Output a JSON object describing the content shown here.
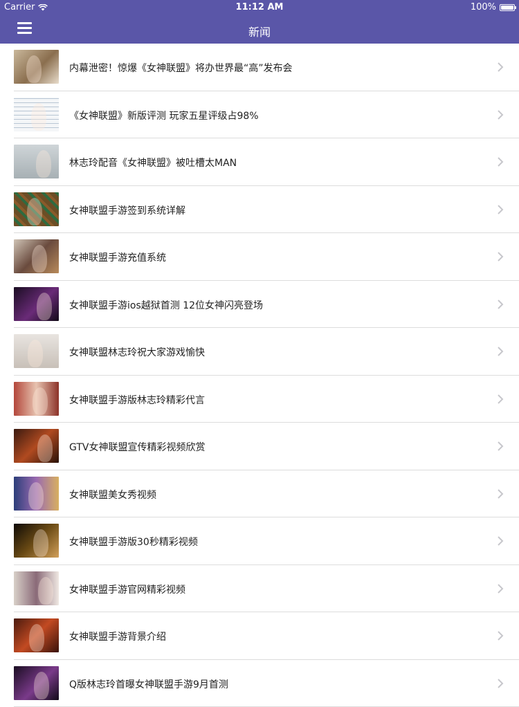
{
  "status": {
    "carrier": "Carrier",
    "time": "11:12 AM",
    "battery": "100%"
  },
  "nav": {
    "title": "新闻"
  },
  "items": [
    {
      "title": "内幕泄密！惊爆《女神联盟》将办世界最“高”发布会",
      "bg": "linear-gradient(135deg,#c9b79b,#8a6e4e 55%,#e8dccb)"
    },
    {
      "title": "《女神联盟》新版评测 玩家五星评级占98%",
      "bg": "repeating-linear-gradient(0deg,#f4f6f8 0 5px,#b9c6d4 5px 6px)"
    },
    {
      "title": "林志玲配音《女神联盟》被吐槽太MAN",
      "bg": "linear-gradient(180deg,#cfd5d8,#a7b0b4)"
    },
    {
      "title": "女神联盟手游签到系统详解",
      "bg": "repeating-linear-gradient(45deg,#6b4e26 0 6px,#2f6a3f 6px 10px,#8a5a2a 10px 14px)"
    },
    {
      "title": "女神联盟手游充值系统",
      "bg": "linear-gradient(135deg,#cfc3b5,#6a4b3e 50%,#b88a5a)"
    },
    {
      "title": "女神联盟手游ios越狱首测 12位女神闪亮登场",
      "bg": "linear-gradient(135deg,#1a0d22,#6a2b78 55%,#120a18)"
    },
    {
      "title": "女神联盟林志玲祝大家游戏愉快",
      "bg": "linear-gradient(180deg,#e8e4e0,#c8c0b8)"
    },
    {
      "title": "女神联盟手游版林志玲精彩代言",
      "bg": "linear-gradient(90deg,#b3473b,#e7c3b0 50%,#8c3228)"
    },
    {
      "title": "GTV女神联盟宣传精彩视频欣赏",
      "bg": "linear-gradient(135deg,#3a1a10,#b04a20 50%,#2a1208)"
    },
    {
      "title": "女神联盟美女秀视频",
      "bg": "linear-gradient(90deg,#2c3e7a,#9a6ab0 50%,#d8b060)"
    },
    {
      "title": "女神联盟手游版30秒精彩视频",
      "bg": "linear-gradient(135deg,#0e0a06,#6a4a14 50%,#d2a05a)"
    },
    {
      "title": "女神联盟手游官网精彩视频",
      "bg": "linear-gradient(90deg,#d8d0c8,#8a6a78 50%,#efe8e2)"
    },
    {
      "title": "女神联盟手游背景介绍",
      "bg": "linear-gradient(135deg,#4a1a0e,#c24a22 50%,#3a120a)"
    },
    {
      "title": "Q版林志玲首曝女神联盟手游9月首测",
      "bg": "linear-gradient(135deg,#1a0d22,#7a3a8a 55%,#120a18)"
    }
  ]
}
